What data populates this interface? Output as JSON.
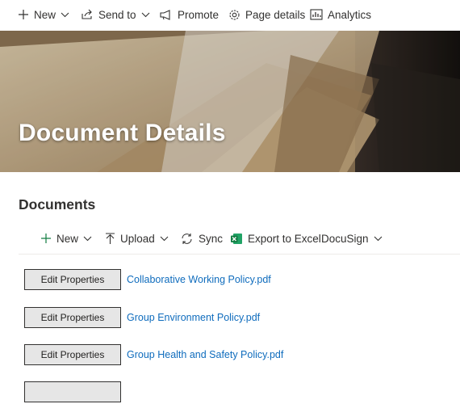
{
  "commandbar": {
    "new_label": "New",
    "sendto_label": "Send to",
    "promote_label": "Promote",
    "pagedetails_label": "Page details",
    "analytics_label": "Analytics"
  },
  "hero": {
    "title": "Document Details"
  },
  "documents": {
    "section_title": "Documents",
    "toolbar": {
      "new_label": "New",
      "upload_label": "Upload",
      "sync_label": "Sync",
      "export_label": "Export to Excel",
      "docusign_label": "DocuSign"
    },
    "rows": [
      {
        "button_label": "Edit Properties",
        "file_name": "Collaborative Working Policy.pdf"
      },
      {
        "button_label": "Edit Properties",
        "file_name": "Group Environment Policy.pdf"
      },
      {
        "button_label": "Edit Properties",
        "file_name": "Group Health and Safety Policy.pdf"
      },
      {
        "button_label": "",
        "file_name": ""
      }
    ]
  },
  "colors": {
    "link": "#0f6cbd",
    "text": "#323130",
    "excel_green": "#107c41",
    "button_bg": "#e6e6e6"
  }
}
